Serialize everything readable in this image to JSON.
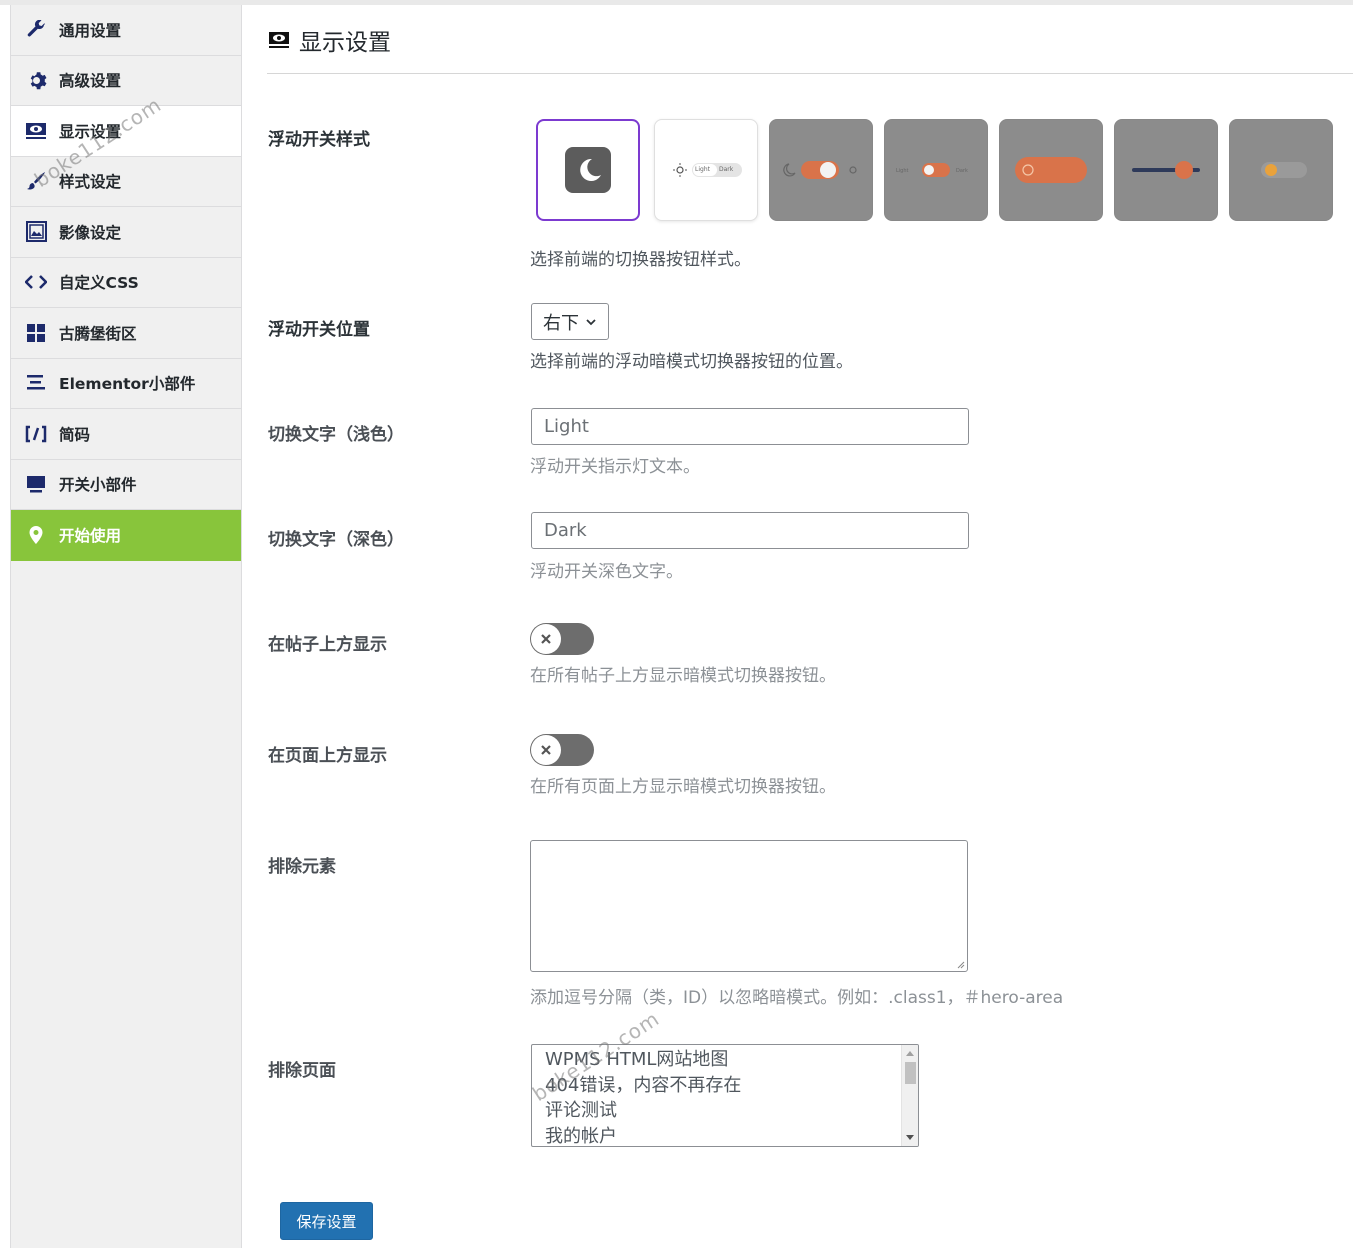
{
  "sidebar": {
    "items": [
      {
        "label": "通用设置",
        "icon": "wrench-icon"
      },
      {
        "label": "高级设置",
        "icon": "gear-icon"
      },
      {
        "label": "显示设置",
        "icon": "display-eye-icon"
      },
      {
        "label": "样式设定",
        "icon": "brush-icon"
      },
      {
        "label": "影像设定",
        "icon": "image-icon"
      },
      {
        "label": "自定义CSS",
        "icon": "code-icon"
      },
      {
        "label": "古腾堡街区",
        "icon": "blocks-icon"
      },
      {
        "label": "Elementor小部件",
        "icon": "elementor-icon"
      },
      {
        "label": "简码",
        "icon": "shortcode-icon"
      },
      {
        "label": "开关小部件",
        "icon": "monitor-icon"
      },
      {
        "label": "开始使用",
        "icon": "location-pin-icon"
      }
    ],
    "active_index": 2
  },
  "page": {
    "title": "显示设置"
  },
  "switch_style": {
    "label": "浮动开关样式",
    "description": "选择前端的切换器按钮样式。",
    "option_light_text": "Light",
    "option_dark_text": "Dark",
    "option_icons": [
      "moon-icon",
      "sun-moon-pill-icon",
      "moon-sun-toggle-icon",
      "light-dark-toggle-icon",
      "sun-pill-icon",
      "slider-icon",
      "sun-toggle-icon"
    ],
    "selected_index": 0
  },
  "switch_position": {
    "label": "浮动开关位置",
    "value": "右下",
    "description": "选择前端的浮动暗模式切换器按钮的位置。"
  },
  "text_light": {
    "label": "切换文字（浅色）",
    "placeholder": "Light",
    "description": "浮动开关指示灯文本。"
  },
  "text_dark": {
    "label": "切换文字（深色）",
    "placeholder": "Dark",
    "description": "浮动开关深色文字。"
  },
  "show_above_posts": {
    "label": "在帖子上方显示",
    "enabled": false,
    "description": "在所有帖子上方显示暗模式切换器按钮。"
  },
  "show_above_pages": {
    "label": "在页面上方显示",
    "enabled": false,
    "description": "在所有页面上方显示暗模式切换器按钮。"
  },
  "exclude_elements": {
    "label": "排除元素",
    "value": "",
    "description": "添加逗号分隔（类，ID）以忽略暗模式。例如：.class1，＃hero-area"
  },
  "exclude_pages": {
    "label": "排除页面",
    "options": [
      "WPMS HTML网站地图",
      "404错误，内容不再存在",
      "评论测试",
      "我的帐户"
    ]
  },
  "save_button": "保存设置",
  "watermark": "boke112.com"
}
